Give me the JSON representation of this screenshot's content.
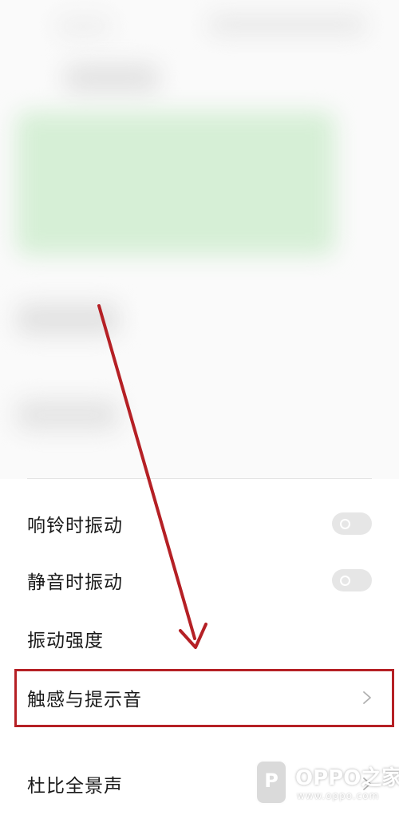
{
  "settings": {
    "items": [
      {
        "label": "响铃时振动",
        "control": "toggle",
        "state": "off"
      },
      {
        "label": "静音时振动",
        "control": "toggle",
        "state": "off"
      },
      {
        "label": "振动强度",
        "control": "none"
      },
      {
        "label": "触感与提示音",
        "control": "chevron",
        "highlighted": true
      },
      {
        "label": "杜比全景声",
        "control": "chevron"
      }
    ]
  },
  "annotation": {
    "arrow_color": "#b52025",
    "box_color": "#b52025"
  },
  "watermark": {
    "logo_letter": "P",
    "brand": "OPPO之家",
    "url": "www.oppo.com"
  },
  "colors": {
    "toggle_off": "#e6e6e6",
    "divider": "#e4e4e4",
    "blurred_card": "#d6efd6"
  }
}
